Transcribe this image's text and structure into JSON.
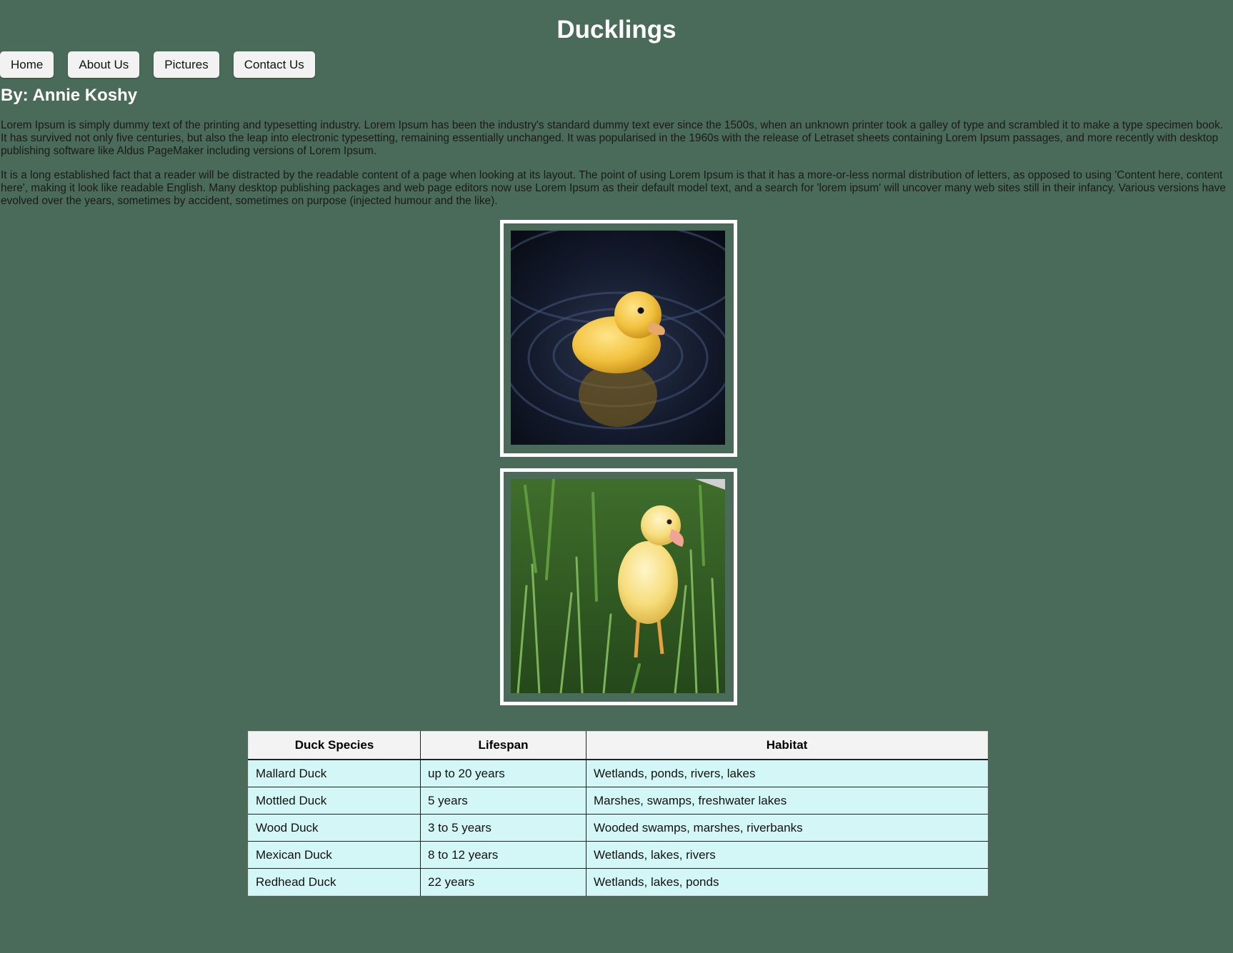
{
  "page": {
    "title": "Ducklings",
    "byline": "By: Annie Koshy"
  },
  "nav": {
    "items": [
      {
        "label": "Home"
      },
      {
        "label": "About Us"
      },
      {
        "label": "Pictures"
      },
      {
        "label": "Contact Us"
      }
    ]
  },
  "content": {
    "paragraphs": [
      "Lorem Ipsum is simply dummy text of the printing and typesetting industry. Lorem Ipsum has been the industry's standard dummy text ever since the 1500s, when an unknown printer took a galley of type and scrambled it to make a type specimen book. It has survived not only five centuries, but also the leap into electronic typesetting, remaining essentially unchanged. It was popularised in the 1960s with the release of Letraset sheets containing Lorem Ipsum passages, and more recently with desktop publishing software like Aldus PageMaker including versions of Lorem Ipsum.",
      "It is a long established fact that a reader will be distracted by the readable content of a page when looking at its layout. The point of using Lorem Ipsum is that it has a more-or-less normal distribution of letters, as opposed to using 'Content here, content here', making it look like readable English. Many desktop publishing packages and web page editors now use Lorem Ipsum as their default model text, and a search for 'lorem ipsum' will uncover many web sites still in their infancy. Various versions have evolved over the years, sometimes by accident, sometimes on purpose (injected humour and the like)."
    ]
  },
  "table": {
    "headers": [
      "Duck Species",
      "Lifespan",
      "Habitat"
    ],
    "rows": [
      [
        "Mallard Duck",
        "up to 20 years",
        "Wetlands, ponds, rivers, lakes"
      ],
      [
        "Mottled Duck",
        "5 years",
        "Marshes, swamps, freshwater lakes"
      ],
      [
        "Wood Duck",
        "3 to 5 years",
        "Wooded swamps, marshes, riverbanks"
      ],
      [
        "Mexican Duck",
        "8 to 12 years",
        "Wetlands, lakes, rivers"
      ],
      [
        "Redhead Duck",
        "22 years",
        "Wetlands, lakes, ponds"
      ]
    ]
  },
  "colors": {
    "page_background": "#4a6a5a",
    "heading_text": "#ffffff",
    "table_cell_background": "#d3f7f7",
    "table_header_background": "#f3f3f3"
  }
}
